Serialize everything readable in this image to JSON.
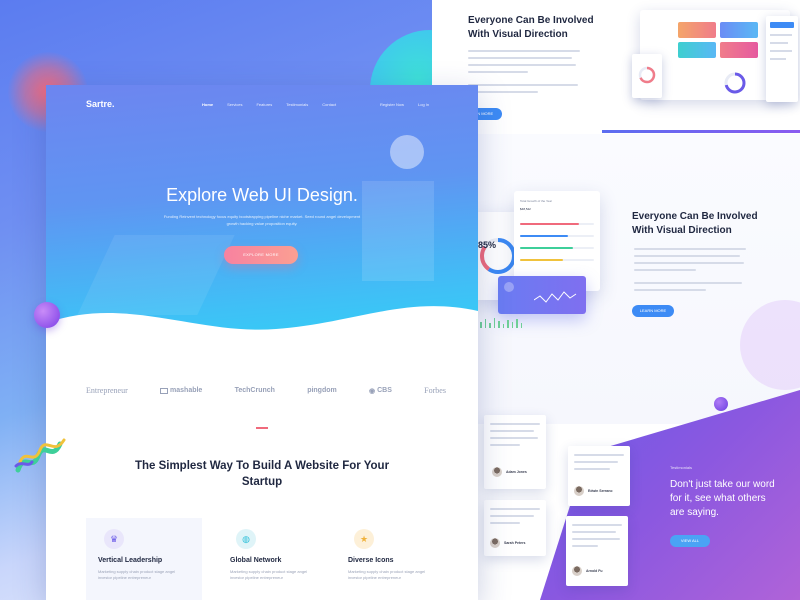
{
  "nav": {
    "logo": "Sartre.",
    "items": [
      "Home",
      "Services",
      "Features",
      "Testimonials",
      "Contact"
    ],
    "right": [
      "Register Now",
      "Log In"
    ]
  },
  "hero": {
    "title": "Explore Web UI Design.",
    "subtitle": "Funding Reinvent technology focus equity bootstrapping pipeline niche market. Seed round angel development growth hacking value proposition equity.",
    "button": "EXPLORE MORE"
  },
  "brands": [
    "Entrepreneur",
    "mashable",
    "TechCrunch",
    "pingdom",
    "CBS",
    "Forbes"
  ],
  "section": {
    "title": "The Simplest Way To Build A Website For Your Startup"
  },
  "features": [
    {
      "title": "Vertical Leadership",
      "icon": "trophy-icon",
      "color": "#e9e6fb",
      "icon_color": "#6a5ae8",
      "text": "Marketing supply chain product stage angel investor pipeline entrepreneur"
    },
    {
      "title": "Global Network",
      "icon": "globe-icon",
      "color": "#dff4f8",
      "icon_color": "#2cbfd8",
      "text": "Marketing supply chain product stage angel investor pipeline entrepreneur"
    },
    {
      "title": "Diverse Icons",
      "icon": "star-icon",
      "color": "#fdf0d8",
      "icon_color": "#f0b23c",
      "text": "Marketing supply chain product stage angel investor pipeline entrepreneur"
    }
  ],
  "upper": {
    "title": "Everyone Can Be Involved With Visual Direction",
    "button": "LEARN MORE"
  },
  "middle": {
    "title": "Everyone Can Be Involved With Visual Direction",
    "button": "LEARN MORE",
    "donut_value": "85%",
    "stat_header": "Total Growth of the Year",
    "stat_total": "$48,542"
  },
  "testimonials": {
    "eyebrow": "Testimonials",
    "quote": "Don't just take our word for it, see what others are saying.",
    "button": "VIEW ALL",
    "people": [
      "Adam Jones",
      "Edwin Serrano",
      "Sarah Peters",
      "Arnold Fu"
    ]
  },
  "colors": {
    "hero_from": "#6d85f0",
    "hero_to": "#2fd5f4",
    "accent_pink": "#f782a0",
    "accent_blue": "#3d8bf5",
    "purple": "#8b58e0"
  }
}
